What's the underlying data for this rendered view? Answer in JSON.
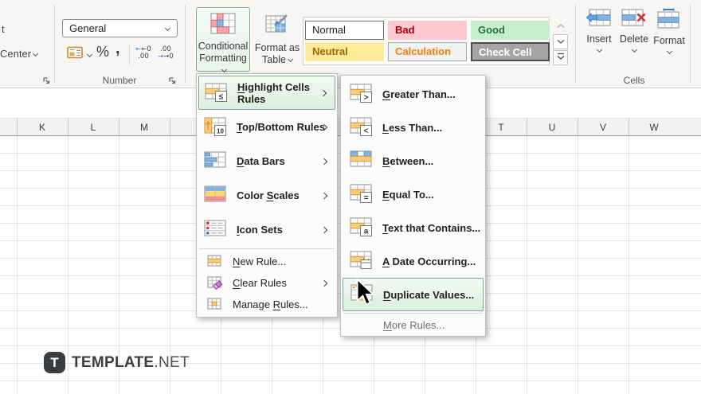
{
  "ribbon": {
    "alignment": {
      "wrap_text_fragment": "t",
      "merge_center_label": "Center"
    },
    "number": {
      "format_value": "General",
      "percent_label": "%",
      "comma_label": ",",
      "inc_decimal_top": "←0",
      "inc_decimal_bottom": ".00",
      "dec_decimal_top": ".00",
      "dec_decimal_bottom": "→0",
      "group_label": "Number"
    },
    "styles": {
      "conditional_formatting_line1": "Conditional",
      "conditional_formatting_line2": "Formatting",
      "format_as_table_line1": "Format as",
      "format_as_table_line2": "Table",
      "gallery": [
        {
          "label": "Normal",
          "bg": "#ffffff",
          "color": "#1f1f1f",
          "border": "#6e6e6e",
          "weight": "normal"
        },
        {
          "label": "Bad",
          "bg": "#ffc7ce",
          "color": "#9c0006",
          "border": "#ffc7ce",
          "weight": "bold"
        },
        {
          "label": "Good",
          "bg": "#c6efce",
          "color": "#276f43",
          "border": "#c6efce",
          "weight": "bold"
        },
        {
          "label": "Neutral",
          "bg": "#ffeb9c",
          "color": "#9c6500",
          "border": "#ffeb9c",
          "weight": "bold"
        },
        {
          "label": "Calculation",
          "bg": "#f2f2f2",
          "color": "#fa7d00",
          "border": "#a9a7a5",
          "weight": "bold"
        },
        {
          "label": "Check Cell",
          "bg": "#a5a5a5",
          "color": "#ffffff",
          "border": "#4d4d4d",
          "weight": "bold"
        }
      ]
    },
    "cells": {
      "group_label": "Cells",
      "insert_label": "Insert",
      "delete_label": "Delete",
      "format_label": "Format"
    }
  },
  "sheet": {
    "columns": [
      "K",
      "L",
      "M",
      "T",
      "U",
      "V",
      "W"
    ]
  },
  "menu": {
    "items": [
      {
        "pre": "",
        "accel": "H",
        "post": "ighlight Cells Rules",
        "has_submenu": true,
        "selected": true
      },
      {
        "pre": "",
        "accel": "T",
        "post": "op/Bottom Rules",
        "has_submenu": true
      },
      {
        "pre": "",
        "accel": "D",
        "post": "ata Bars",
        "has_submenu": true
      },
      {
        "pre": "Color ",
        "accel": "S",
        "post": "cales",
        "has_submenu": true
      },
      {
        "pre": "",
        "accel": "I",
        "post": "con Sets",
        "has_submenu": true
      },
      {
        "pre": "",
        "accel": "N",
        "post": "ew Rule..."
      },
      {
        "pre": "",
        "accel": "C",
        "post": "lear Rules",
        "has_submenu": true
      },
      {
        "pre": "Manage ",
        "accel": "R",
        "post": "ules..."
      }
    ]
  },
  "submenu": {
    "items": [
      {
        "pre": "",
        "accel": "G",
        "post": "reater Than..."
      },
      {
        "pre": "",
        "accel": "L",
        "post": "ess Than..."
      },
      {
        "pre": "",
        "accel": "B",
        "post": "etween..."
      },
      {
        "pre": "",
        "accel": "E",
        "post": "qual To..."
      },
      {
        "pre": "",
        "accel": "T",
        "post": "ext that Contains..."
      },
      {
        "pre": "",
        "accel": "A",
        "post": " Date Occurring..."
      },
      {
        "pre": "",
        "accel": "D",
        "post": "uplicate Values...",
        "selected": true
      },
      {
        "pre": "",
        "accel": "M",
        "post": "ore Rules...",
        "disabled_look": true
      }
    ]
  },
  "watermark": {
    "logo_letter": "T",
    "brand": "TEMPLATE",
    "suffix": ".NET"
  },
  "icons": {
    "conditional-formatting-icon": "grid-with-red-and-blue-cells",
    "format-as-table-icon": "grid-with-paintbrush",
    "highlight-cells-rules-icon": "grid-orange-cell-lte-badge",
    "top-bottom-rules-icon": "grid-orange-arrow-10-badge",
    "data-bars-icon": "grid-blue-bars",
    "color-scales-icon": "blue-yellow-red-bands",
    "icon-sets-icon": "grid-colored-dots",
    "new-rule-icon": "small-grid-orange-row",
    "clear-rules-icon": "small-grid-eraser",
    "manage-rules-icon": "small-grid-orange-cell",
    "greater-than-icon": "grid-orange-cell-gt-badge",
    "less-than-icon": "grid-orange-cell-lt-badge",
    "between-icon": "grid-blue-corners-orange-row",
    "equal-to-icon": "grid-orange-cell-eq-badge",
    "text-contains-icon": "grid-orange-cell-a-badge",
    "date-occurring-icon": "grid-orange-cell-calendar-badge",
    "duplicate-values-icon": "grid-orange-column-sparkle",
    "insert-cells-icon": "grid-blue-left-arrow",
    "delete-cells-icon": "grid-red-x",
    "format-cells-icon": "grid-blue-ruler",
    "accounting-format-icon": "orange-card",
    "dialog-launcher-icon": "corner-arrow"
  },
  "colors": {
    "selection_green_border": "#73ad88",
    "accent_orange": "#f9cb7e",
    "accent_blue": "#85b3e0",
    "accent_red": "#f2a4a8"
  }
}
